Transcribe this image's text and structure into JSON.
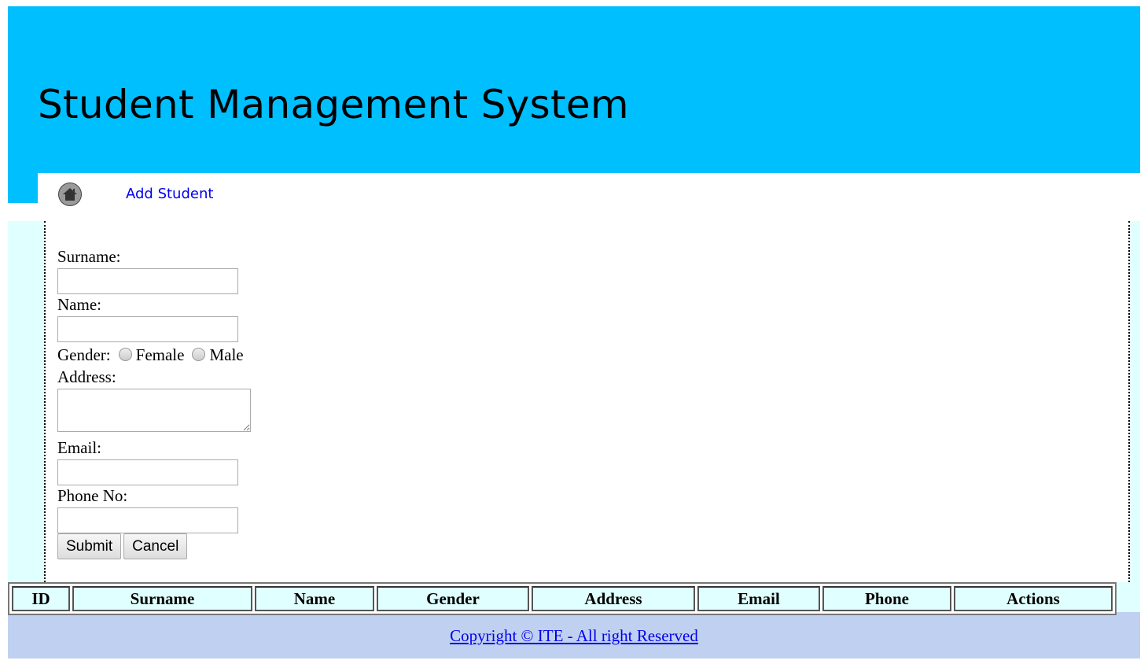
{
  "header": {
    "title": "Student Management System"
  },
  "nav": {
    "home_icon": "home-icon",
    "add_student": "Add Student"
  },
  "form": {
    "surname_label": "Surname:",
    "name_label": "Name:",
    "gender_label": "Gender:",
    "gender_options": [
      "Female",
      "Male"
    ],
    "address_label": "Address:",
    "email_label": "Email:",
    "phone_label": "Phone No:",
    "submit": "Submit",
    "cancel": "Cancel"
  },
  "table": {
    "headers": [
      "ID",
      "Surname",
      "Name",
      "Gender",
      "Address",
      "Email",
      "Phone",
      "Actions"
    ]
  },
  "footer": {
    "copyright": "Copyright © ITE - All right Reserved"
  },
  "colors": {
    "header": "#00bfff",
    "content_bg": "#e0ffff",
    "footer": "#c0d0f0"
  }
}
